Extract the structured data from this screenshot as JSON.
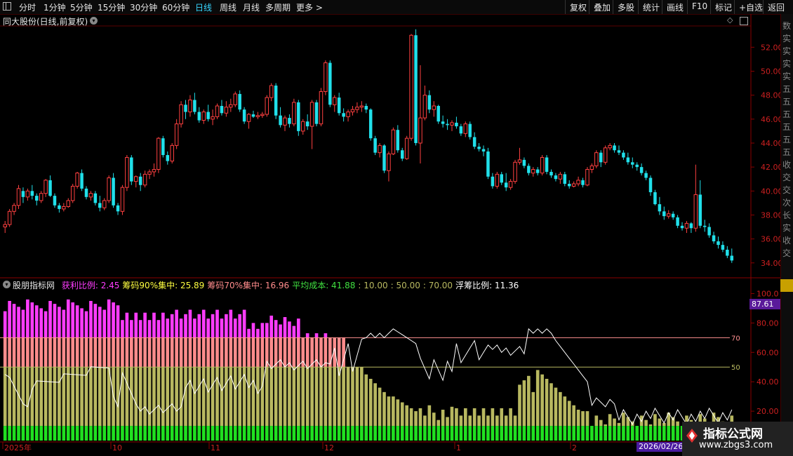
{
  "toolbar": {
    "periods": [
      "分时",
      "1分钟",
      "5分钟",
      "15分钟",
      "30分钟",
      "60分钟",
      "日线",
      "周线",
      "月线",
      "多周期",
      "更多 >"
    ],
    "active_period": "日线",
    "right_buttons": [
      "复权",
      "叠加",
      "多股",
      "统计",
      "画线",
      "F10",
      "标记",
      "+自选",
      "返回"
    ]
  },
  "stock": {
    "title": "同大股份(日线,前复权)"
  },
  "indicator": {
    "name": "股朋指标网",
    "fields": [
      {
        "label": "获利比例:",
        "value": "2.45",
        "color": "#ff3cff"
      },
      {
        "label": "筹码90%集中:",
        "value": "25.89",
        "color": "#ffff40"
      },
      {
        "label": "筹码70%集中:",
        "value": "16.96",
        "color": "#ff8c8c"
      },
      {
        "label": "平均成本:",
        "value": "41.88",
        "color": "#40e040"
      },
      {
        "label": ":",
        "value": "10.00",
        "color": "#b8b860"
      },
      {
        "label": ":",
        "value": "50.00",
        "color": "#b8b860"
      },
      {
        "label": ":",
        "value": "70.00",
        "color": "#b8b860"
      },
      {
        "label": "浮筹比例:",
        "value": "11.36",
        "color": "#ffffff"
      }
    ],
    "current_value": "87.61",
    "ref_labels": [
      "70",
      "50"
    ]
  },
  "price_axis": [
    "52.00",
    "50.00",
    "48.00",
    "46.00",
    "44.00",
    "42.00",
    "40.00",
    "38.00",
    "36.00",
    "34.00"
  ],
  "ind_axis": [
    "100.0",
    "80.00",
    "60.00",
    "40.00",
    "20.00"
  ],
  "time_axis": [
    "2025年",
    "10",
    "11",
    "12",
    "1",
    "2"
  ],
  "cursor_date": "2026/02/26",
  "sidebar_chars": [
    "数",
    "实",
    "实",
    "实",
    "实",
    "五",
    "五",
    "五",
    "五",
    "五",
    "五",
    "收",
    "交",
    "交",
    "次",
    "长",
    "实",
    "收",
    "交"
  ],
  "watermark": {
    "title": "指标公式网",
    "url": "www.zbgs3.com"
  },
  "colors": {
    "up": "#ff4040",
    "down": "#20e0ea",
    "profit": "#ff3cff",
    "chip70": "#ff8c8c",
    "olive": "#b8b860",
    "green": "#20e020"
  },
  "chart_data": {
    "type": "candlestick",
    "ylim": [
      33,
      54
    ],
    "candles": [
      [
        37.0,
        37.5,
        36.5,
        37.2
      ],
      [
        37.2,
        38.5,
        37.0,
        38.3
      ],
      [
        38.3,
        39.0,
        38.0,
        38.8
      ],
      [
        38.8,
        40.5,
        38.5,
        40.2
      ],
      [
        40.0,
        40.3,
        39.0,
        39.5
      ],
      [
        39.5,
        40.2,
        39.2,
        40.0
      ],
      [
        40.0,
        40.5,
        39.3,
        39.6
      ],
      [
        39.6,
        39.8,
        38.8,
        39.2
      ],
      [
        39.2,
        40.0,
        39.0,
        39.8
      ],
      [
        39.8,
        41.0,
        39.5,
        40.9
      ],
      [
        40.9,
        41.3,
        39.5,
        39.6
      ],
      [
        39.6,
        39.8,
        38.6,
        38.8
      ],
      [
        38.8,
        39.0,
        38.2,
        38.5
      ],
      [
        38.5,
        39.0,
        38.3,
        38.7
      ],
      [
        38.7,
        39.4,
        38.6,
        39.2
      ],
      [
        39.2,
        40.6,
        39.0,
        40.4
      ],
      [
        40.4,
        41.6,
        40.2,
        41.5
      ],
      [
        41.5,
        41.8,
        40.0,
        40.2
      ],
      [
        40.2,
        40.4,
        39.3,
        39.5
      ],
      [
        39.5,
        40.0,
        39.2,
        39.8
      ],
      [
        39.8,
        40.0,
        38.8,
        39.0
      ],
      [
        39.0,
        39.6,
        38.3,
        38.6
      ],
      [
        38.6,
        39.4,
        38.4,
        39.2
      ],
      [
        39.2,
        41.3,
        39.0,
        41.1
      ],
      [
        41.1,
        41.5,
        38.6,
        38.8
      ],
      [
        38.8,
        39.0,
        38.0,
        38.3
      ],
      [
        38.3,
        40.5,
        38.0,
        40.3
      ],
      [
        40.3,
        43.0,
        40.0,
        42.8
      ],
      [
        42.8,
        43.0,
        40.5,
        40.8
      ],
      [
        40.8,
        41.3,
        40.3,
        41.2
      ],
      [
        41.2,
        41.5,
        40.0,
        40.5
      ],
      [
        40.5,
        41.7,
        40.3,
        41.4
      ],
      [
        41.4,
        41.8,
        41.0,
        41.6
      ],
      [
        41.6,
        42.3,
        41.2,
        41.8
      ],
      [
        41.8,
        44.5,
        41.5,
        44.4
      ],
      [
        44.4,
        44.6,
        42.8,
        43.0
      ],
      [
        43.0,
        43.3,
        42.2,
        42.5
      ],
      [
        42.5,
        44.0,
        42.3,
        43.8
      ],
      [
        43.8,
        46.0,
        43.5,
        45.6
      ],
      [
        45.6,
        47.5,
        45.3,
        47.2
      ],
      [
        47.2,
        47.6,
        46.0,
        46.6
      ],
      [
        46.6,
        48.0,
        46.2,
        47.6
      ],
      [
        47.6,
        48.2,
        46.4,
        46.6
      ],
      [
        46.6,
        47.0,
        45.7,
        45.9
      ],
      [
        45.9,
        46.8,
        45.6,
        46.6
      ],
      [
        46.6,
        47.2,
        45.8,
        46.0
      ],
      [
        46.0,
        46.8,
        45.5,
        46.2
      ],
      [
        46.2,
        47.3,
        46.0,
        47.1
      ],
      [
        47.1,
        47.6,
        46.3,
        46.5
      ],
      [
        46.5,
        47.5,
        46.2,
        47.0
      ],
      [
        47.0,
        47.7,
        46.6,
        47.2
      ],
      [
        47.2,
        48.3,
        47.0,
        48.1
      ],
      [
        48.1,
        48.4,
        46.6,
        46.8
      ],
      [
        46.8,
        47.0,
        45.6,
        45.8
      ],
      [
        45.8,
        46.5,
        45.2,
        46.4
      ],
      [
        46.4,
        46.7,
        46.1,
        46.2
      ],
      [
        46.2,
        46.6,
        46.0,
        46.3
      ],
      [
        46.3,
        46.6,
        46.1,
        46.4
      ],
      [
        46.4,
        48.0,
        46.2,
        47.8
      ],
      [
        47.8,
        49.0,
        47.5,
        48.8
      ],
      [
        48.8,
        49.0,
        46.0,
        46.3
      ],
      [
        46.3,
        47.0,
        45.3,
        45.5
      ],
      [
        45.5,
        46.3,
        45.0,
        46.1
      ],
      [
        46.1,
        46.4,
        45.3,
        45.6
      ],
      [
        45.6,
        47.7,
        45.4,
        47.4
      ],
      [
        47.4,
        47.6,
        44.6,
        45.0
      ],
      [
        45.0,
        46.0,
        44.7,
        45.8
      ],
      [
        45.8,
        46.4,
        45.1,
        45.4
      ],
      [
        45.4,
        47.6,
        43.5,
        47.4
      ],
      [
        47.4,
        47.6,
        45.4,
        45.6
      ],
      [
        45.6,
        48.6,
        45.4,
        48.3
      ],
      [
        48.3,
        50.9,
        48.0,
        50.7
      ],
      [
        50.7,
        50.9,
        47.0,
        47.2
      ],
      [
        47.2,
        48.0,
        46.6,
        47.8
      ],
      [
        47.8,
        48.2,
        46.3,
        46.5
      ],
      [
        46.5,
        46.9,
        45.8,
        46.2
      ],
      [
        46.2,
        46.8,
        45.8,
        46.6
      ],
      [
        46.6,
        47.1,
        46.3,
        46.8
      ],
      [
        46.8,
        47.4,
        46.5,
        47.0
      ],
      [
        47.0,
        47.5,
        46.6,
        47.1
      ],
      [
        47.1,
        47.3,
        46.5,
        46.8
      ],
      [
        46.8,
        46.9,
        44.2,
        44.4
      ],
      [
        44.4,
        44.6,
        43.0,
        43.2
      ],
      [
        43.2,
        44.0,
        42.8,
        43.8
      ],
      [
        43.8,
        43.9,
        41.5,
        41.7
      ],
      [
        41.7,
        43.3,
        40.8,
        43.1
      ],
      [
        43.1,
        45.3,
        43.0,
        45.1
      ],
      [
        45.1,
        45.5,
        43.2,
        43.4
      ],
      [
        43.4,
        43.6,
        42.5,
        42.7
      ],
      [
        42.7,
        44.6,
        42.6,
        44.4
      ],
      [
        44.4,
        53.1,
        44.2,
        53.0
      ],
      [
        53.0,
        53.5,
        43.8,
        44.0
      ],
      [
        44.0,
        50.5,
        42.3,
        46.1
      ],
      [
        46.1,
        48.8,
        45.9,
        48.0
      ],
      [
        48.0,
        48.4,
        46.5,
        46.8
      ],
      [
        46.8,
        47.5,
        46.2,
        47.1
      ],
      [
        47.1,
        47.2,
        45.6,
        45.8
      ],
      [
        45.8,
        46.3,
        45.3,
        45.6
      ],
      [
        45.6,
        46.0,
        45.1,
        45.5
      ],
      [
        45.5,
        45.9,
        45.0,
        45.7
      ],
      [
        45.7,
        46.2,
        45.2,
        45.4
      ],
      [
        45.4,
        45.6,
        44.6,
        44.8
      ],
      [
        44.8,
        45.8,
        44.5,
        45.6
      ],
      [
        45.6,
        45.8,
        44.3,
        44.5
      ],
      [
        44.5,
        44.9,
        43.5,
        43.7
      ],
      [
        43.7,
        44.0,
        43.3,
        43.5
      ],
      [
        43.5,
        43.8,
        42.9,
        43.3
      ],
      [
        43.3,
        43.6,
        41.0,
        41.2
      ],
      [
        41.2,
        41.5,
        40.2,
        40.4
      ],
      [
        40.4,
        41.6,
        40.2,
        41.4
      ],
      [
        41.4,
        41.6,
        40.5,
        40.7
      ],
      [
        40.7,
        41.5,
        40.0,
        40.3
      ],
      [
        40.3,
        41.0,
        40.1,
        40.8
      ],
      [
        40.8,
        42.6,
        40.6,
        42.4
      ],
      [
        42.4,
        43.6,
        42.2,
        42.6
      ],
      [
        42.6,
        42.8,
        41.9,
        42.1
      ],
      [
        42.1,
        42.3,
        41.3,
        41.5
      ],
      [
        41.5,
        42.0,
        41.2,
        41.8
      ],
      [
        41.8,
        42.0,
        41.3,
        41.5
      ],
      [
        41.5,
        43.0,
        41.3,
        42.8
      ],
      [
        42.8,
        43.0,
        41.4,
        41.6
      ],
      [
        41.6,
        41.8,
        41.1,
        41.3
      ],
      [
        41.3,
        41.5,
        40.8,
        41.0
      ],
      [
        41.0,
        41.6,
        40.6,
        41.4
      ],
      [
        41.4,
        41.6,
        40.4,
        40.6
      ],
      [
        40.6,
        40.9,
        40.2,
        40.4
      ],
      [
        40.4,
        40.8,
        40.3,
        40.6
      ],
      [
        40.6,
        41.2,
        40.4,
        40.9
      ],
      [
        40.9,
        41.1,
        40.3,
        40.5
      ],
      [
        40.5,
        42.0,
        40.4,
        41.8
      ],
      [
        41.8,
        42.3,
        41.5,
        42.1
      ],
      [
        42.1,
        43.4,
        41.9,
        43.2
      ],
      [
        43.2,
        43.4,
        42.0,
        42.4
      ],
      [
        42.4,
        43.8,
        42.2,
        43.6
      ],
      [
        43.6,
        44.0,
        43.4,
        43.8
      ],
      [
        43.8,
        44.0,
        43.2,
        43.4
      ],
      [
        43.4,
        43.8,
        43.0,
        43.2
      ],
      [
        43.2,
        43.4,
        42.6,
        42.8
      ],
      [
        42.8,
        43.2,
        42.2,
        42.4
      ],
      [
        42.4,
        42.8,
        41.9,
        42.2
      ],
      [
        42.2,
        42.4,
        41.7,
        42.0
      ],
      [
        42.0,
        42.3,
        41.3,
        41.5
      ],
      [
        41.5,
        41.7,
        40.9,
        41.1
      ],
      [
        41.1,
        41.3,
        39.6,
        39.9
      ],
      [
        39.9,
        40.1,
        38.8,
        38.9
      ],
      [
        38.9,
        39.5,
        38.0,
        38.3
      ],
      [
        38.3,
        38.7,
        37.6,
        37.9
      ],
      [
        37.9,
        38.4,
        37.7,
        38.1
      ],
      [
        38.1,
        38.3,
        37.6,
        37.8
      ],
      [
        37.8,
        38.0,
        36.9,
        37.1
      ],
      [
        37.1,
        37.4,
        36.7,
        36.9
      ],
      [
        36.9,
        37.5,
        36.5,
        37.3
      ],
      [
        37.3,
        37.4,
        36.5,
        36.9
      ],
      [
        36.9,
        42.2,
        36.6,
        39.7
      ],
      [
        39.7,
        40.9,
        36.9,
        37.1
      ],
      [
        37.1,
        37.6,
        36.6,
        37.0
      ],
      [
        37.0,
        37.3,
        36.1,
        36.3
      ],
      [
        36.3,
        36.6,
        35.6,
        35.8
      ],
      [
        35.8,
        36.2,
        35.2,
        35.5
      ],
      [
        35.5,
        35.8,
        34.9,
        35.1
      ],
      [
        35.1,
        35.4,
        34.4,
        34.6
      ],
      [
        34.6,
        35.2,
        34.0,
        34.2
      ]
    ],
    "x_ticks": [
      "2025年",
      "10",
      "11",
      "12",
      "1",
      "2"
    ]
  }
}
